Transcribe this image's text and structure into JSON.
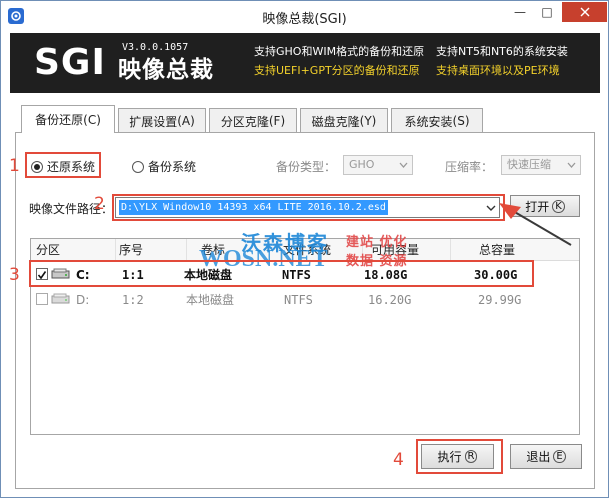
{
  "window": {
    "title": "映像总裁(SGI)",
    "min_glyph": "—",
    "max_glyph": "□"
  },
  "banner": {
    "logo": "SGI",
    "version": "V3.0.0.1057",
    "brand_cn": "映像总裁",
    "features": [
      {
        "text": "支持GHO和WIM格式的备份和还原",
        "color": "white"
      },
      {
        "text": "支持NT5和NT6的系统安装",
        "color": "white"
      },
      {
        "text": "支持UEFI+GPT分区的备份和还原",
        "color": "yellow"
      },
      {
        "text": "支持桌面环境以及PE环境",
        "color": "yellow"
      }
    ]
  },
  "tabs": [
    {
      "label": "备份还原",
      "key": "C",
      "active": true
    },
    {
      "label": "扩展设置",
      "key": "A",
      "active": false
    },
    {
      "label": "分区克隆",
      "key": "F",
      "active": false
    },
    {
      "label": "磁盘克隆",
      "key": "Y",
      "active": false
    },
    {
      "label": "系统安装",
      "key": "S",
      "active": false
    }
  ],
  "options": {
    "restore_label": "还原系统",
    "backup_label": "备份系统",
    "backup_type_label": "备份类型：",
    "backup_type_value": "GHO",
    "compress_label": "压缩率：",
    "compress_value": "快速压缩"
  },
  "path": {
    "label": "映像文件路径：",
    "value": "D:\\YLX Window10 14393 x64 LITE 2016.10.2.esd",
    "open_label": "打开",
    "open_key": "K"
  },
  "table": {
    "headers": [
      "分区",
      "序号",
      "卷标",
      "文件系统",
      "可用容量",
      "总容量"
    ],
    "rows": [
      {
        "drive": "C:",
        "index": "1:1",
        "label": "本地磁盘",
        "fs": "NTFS",
        "free": "18.08G",
        "total": "30.00G",
        "checked": true
      },
      {
        "drive": "D:",
        "index": "1:2",
        "label": "本地磁盘",
        "fs": "NTFS",
        "free": "16.20G",
        "total": "29.99G",
        "checked": false
      }
    ]
  },
  "actions": {
    "execute_label": "执行",
    "execute_key": "R",
    "exit_label": "退出",
    "exit_key": "E"
  },
  "watermark": {
    "cn": "沃森博客",
    "en": "WOSN.NET",
    "red1": "建站 优化",
    "red2": "数据 资源"
  },
  "annotations": [
    "1",
    "2",
    "3",
    "4"
  ],
  "colors": {
    "annotation_red": "#e24a3a",
    "selection_blue": "#3399ff",
    "banner_bg": "#1f1f1f",
    "feature_yellow": "#f4d22b",
    "close_red": "#c7402d"
  }
}
